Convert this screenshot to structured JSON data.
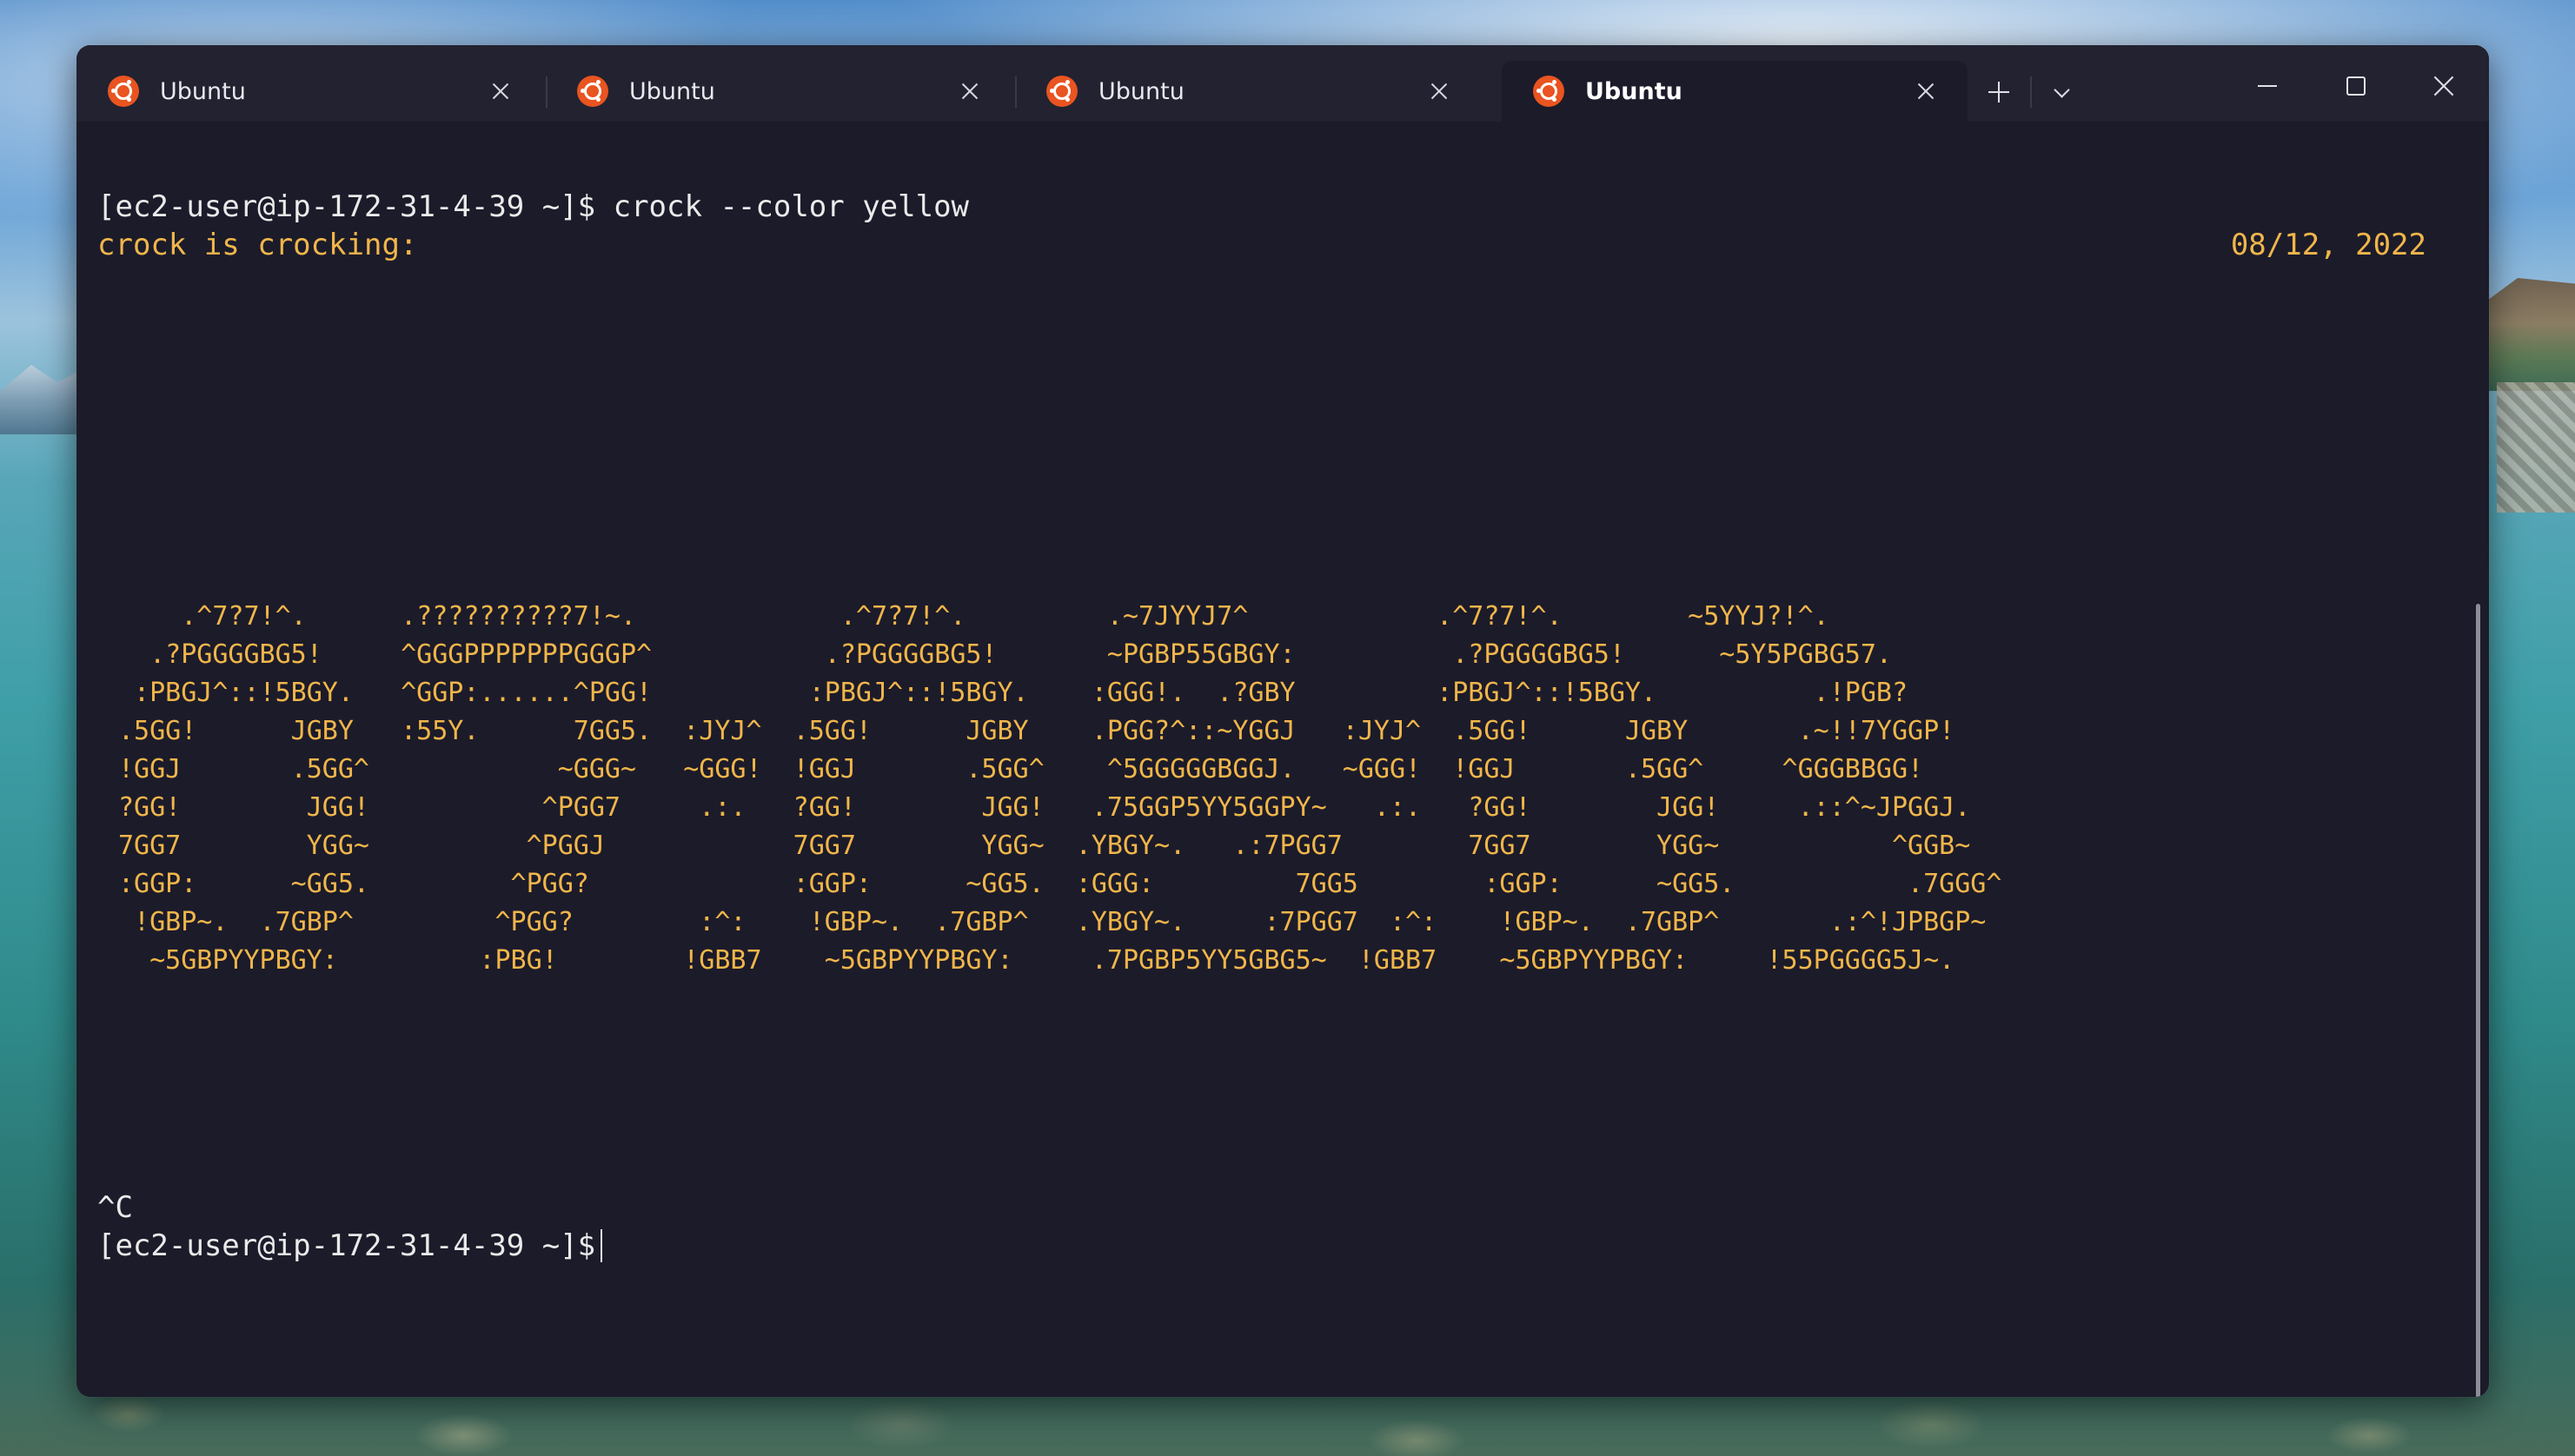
{
  "window": {
    "tabs": [
      {
        "label": "Ubuntu"
      },
      {
        "label": "Ubuntu"
      },
      {
        "label": "Ubuntu"
      },
      {
        "label": "Ubuntu"
      }
    ],
    "active_tab": 3
  },
  "terminal": {
    "prompt_line": "[ec2-user@ip-172-31-4-39 ~]$ crock --color yellow",
    "status": "crock is crocking:",
    "date": "08/12, 2022",
    "ascii_clock": [
      "    .^7?7!^.      .??????????7!~.             .^7?7!^.         .~7JYYJ7^            .^7?7!^.        ~5YYJ?!^.",
      "  .?PGGGGBG5!     ^GGGPPPPPPPGGGP^           .?PGGGGBG5!       ~PGBP55GBGY:          .?PGGGGBG5!      ~5Y5PGBG57.",
      " :PBGJ^::!5BGY.   ^GGP:......^PGG!          :PBGJ^::!5BGY.    :GGG!.  .?GBY         :PBGJ^::!5BGY.          .!PGB?",
      ".5GG!      JGBY   :55Y.      7GG5.  :JYJ^  .5GG!      JGBY    .PGG?^::~YGGJ   :JYJ^  .5GG!      JGBY       .~!!7YGGP!",
      "!GGJ       .5GG^            ~GGG~   ~GGG!  !GGJ       .5GG^    ^5GGGGGBGGJ.   ~GGG!  !GGJ       .5GG^     ^GGGBBGG!",
      "?GG!        JGG!           ^PGG7     .:.   ?GG!        JGG!   .75GGP5YY5GGPY~   .:.   ?GG!        JGG!     .::^~JPGGJ.",
      "7GG7        YGG~          ^PGGJ            7GG7        YGG~  .YBGY~.   .:7PGG7        7GG7        YGG~           ^GGB~",
      ":GGP:      ~GG5.         ^PGG?             :GGP:      ~GG5.  :GGG:         7GG5        :GGP:      ~GG5.           .7GGG^",
      " !GBP~.  .7GBP^         ^PGG?        :^:    !GBP~.  .7GBP^   .YBGY~.     :7PGG7  :^:    !GBP~.  .7GBP^       .:^!JPBGP~",
      "  ~5GBPYYPBGY:         :PBG!        !GBB7    ~5GBPYYPBGY:     .7PGBP5YY5GBG5~  !GBB7    ~5GBPYYPBGY:     !55PGGGG5J~."
    ],
    "interrupt": "^C",
    "prompt": "[ec2-user@ip-172-31-4-39 ~]$"
  },
  "colors": {
    "accent": "#f0b64a",
    "terminal_bg": "#1c1b2a",
    "tab_icon": "#e95420"
  }
}
